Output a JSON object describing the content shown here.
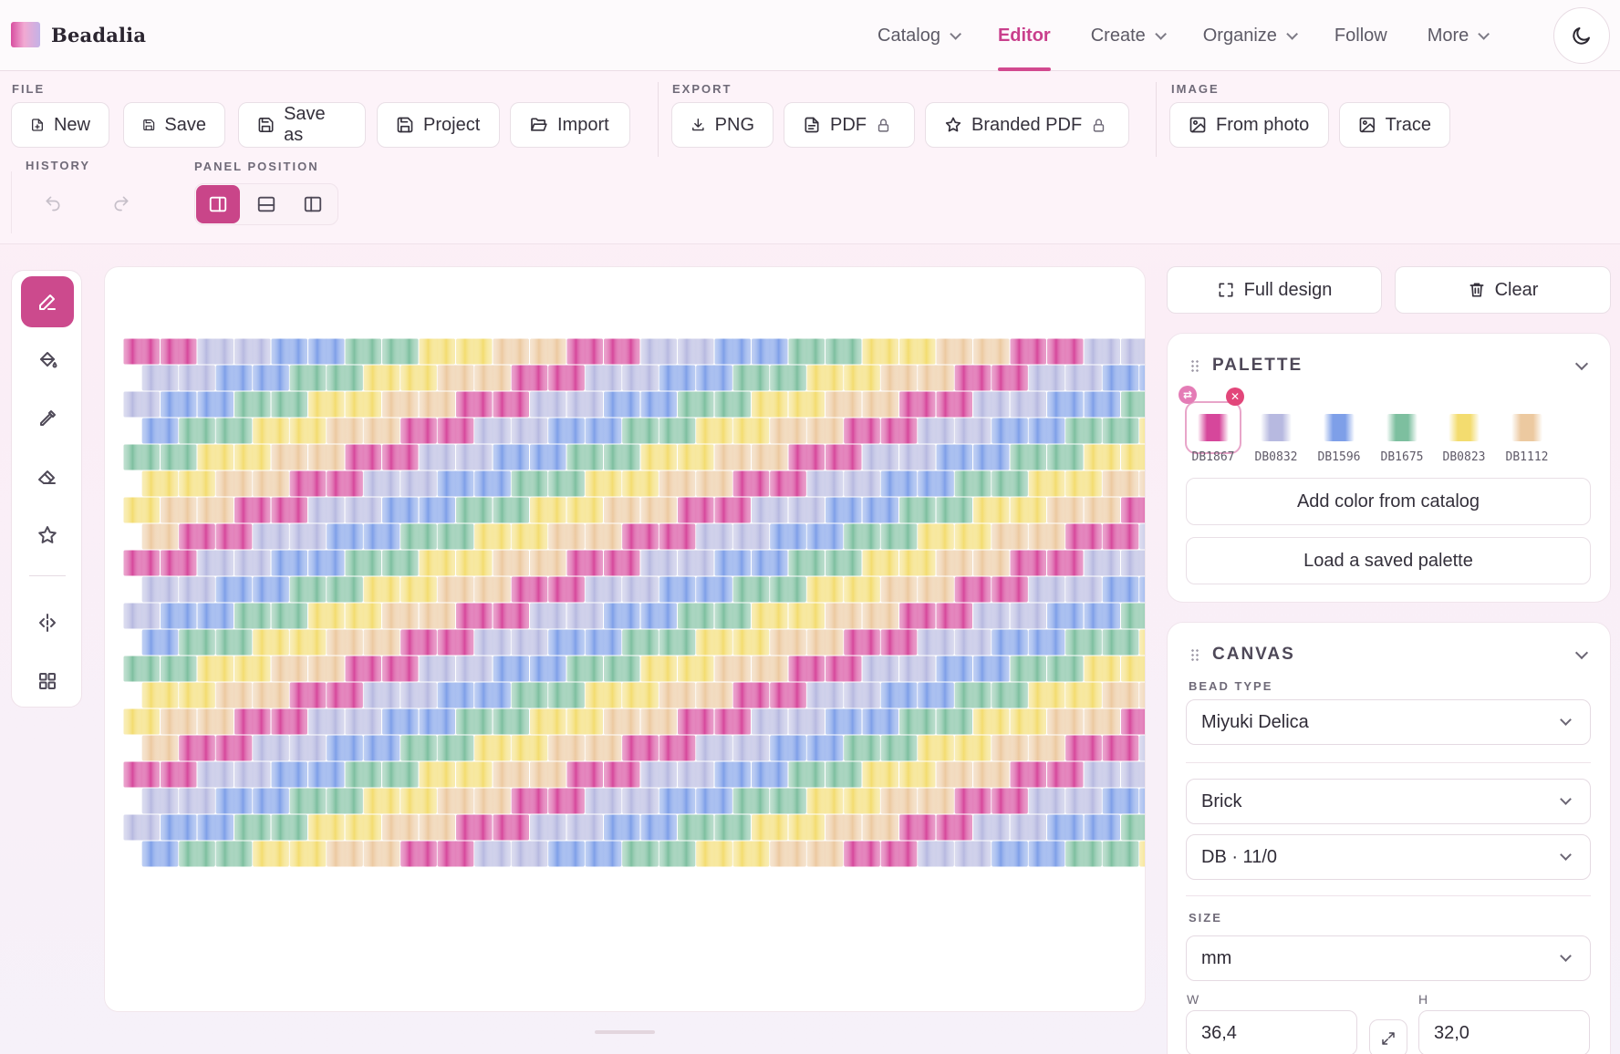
{
  "app": {
    "brand": "Beadalia"
  },
  "nav": {
    "items": [
      {
        "label": "Catalog",
        "dropdown": true,
        "active": false
      },
      {
        "label": "Editor",
        "dropdown": false,
        "active": true
      },
      {
        "label": "Create",
        "dropdown": true,
        "active": false
      },
      {
        "label": "Organize",
        "dropdown": true,
        "active": false
      },
      {
        "label": "Follow",
        "dropdown": false,
        "active": false
      },
      {
        "label": "More",
        "dropdown": true,
        "active": false
      }
    ],
    "theme_icon": "moon-icon"
  },
  "toolbar": {
    "file_label": "FILE",
    "file_buttons": {
      "new": "New",
      "save": "Save",
      "save_as": "Save as",
      "project": "Project",
      "import": "Import"
    },
    "export_label": "EXPORT",
    "export_buttons": {
      "png": "PNG",
      "pdf": "PDF",
      "branded_pdf": "Branded PDF"
    },
    "image_label": "IMAGE",
    "image_buttons": {
      "from_photo": "From photo",
      "trace": "Trace"
    },
    "history_label": "HISTORY",
    "panel_position_label": "PANEL POSITION",
    "panel_position_selected": "right"
  },
  "tools": {
    "items": [
      "pencil-icon",
      "fill-bucket-icon",
      "eyedropper-icon",
      "eraser-icon",
      "star-icon",
      "mirror-icon",
      "grid-icon"
    ],
    "active": "pencil-icon"
  },
  "canvas": {
    "stitch": "brick",
    "rows": 20,
    "columns": 28,
    "pattern_stripe": [
      "DB1867",
      "DB0832",
      "DB1596",
      "DB1675",
      "DB0823",
      "DB1112"
    ]
  },
  "actions": {
    "full_design": "Full design",
    "clear": "Clear"
  },
  "palette": {
    "title": "PALETTE",
    "colors": [
      {
        "code": "DB1867",
        "hex": "#d6479b",
        "selected": true
      },
      {
        "code": "DB0832",
        "hex": "#b7b9e0",
        "selected": false
      },
      {
        "code": "DB1596",
        "hex": "#7e9fe8",
        "selected": false
      },
      {
        "code": "DB1675",
        "hex": "#7dbf9f",
        "selected": false
      },
      {
        "code": "DB0823",
        "hex": "#f3dc6f",
        "selected": false
      },
      {
        "code": "DB1112",
        "hex": "#ecc9a0",
        "selected": false
      }
    ],
    "add_from_catalog": "Add color from catalog",
    "load_saved": "Load a saved palette"
  },
  "canvas_panel": {
    "title": "CANVAS",
    "bead_type_label": "BEAD TYPE",
    "bead_type": "Miyuki Delica",
    "stitch": "Brick",
    "bead_size": "DB · 11/0",
    "size_label": "SIZE",
    "unit": "mm",
    "width_label": "W",
    "width": "36,4",
    "height_label": "H",
    "height": "32,0"
  }
}
